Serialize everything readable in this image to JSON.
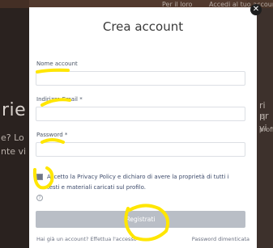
{
  "background": {
    "top_texts": [
      "Per il loro",
      "Accedi al tuo account"
    ],
    "big_text": "rie",
    "side_texts_left": [
      "e? Lo",
      "nte vi"
    ],
    "side_texts_right": [
      "ri pr",
      "ri vi",
      "profi"
    ]
  },
  "modal": {
    "title": "Crea account",
    "fields": [
      {
        "label": "Nome account",
        "value": "",
        "placeholder": ""
      },
      {
        "label": "Indirizzo Email *",
        "value": "",
        "placeholder": ""
      },
      {
        "label": "Password *",
        "value": "",
        "placeholder": ""
      }
    ],
    "consent_text": "Accetto la Privacy Policy e dichiaro di avere la proprietà di tutti i testi e materiali caricati sul profilo.",
    "info_symbol": "?",
    "submit_label": "Registrati",
    "footer_left": "Hai già un account? Effettua l'accesso",
    "footer_right": "Password dimenticata",
    "close_symbol": "✕"
  },
  "colors": {
    "highlight": "#ffe600",
    "button_disabled": "#b9bec6",
    "label_text": "#4a5566"
  }
}
